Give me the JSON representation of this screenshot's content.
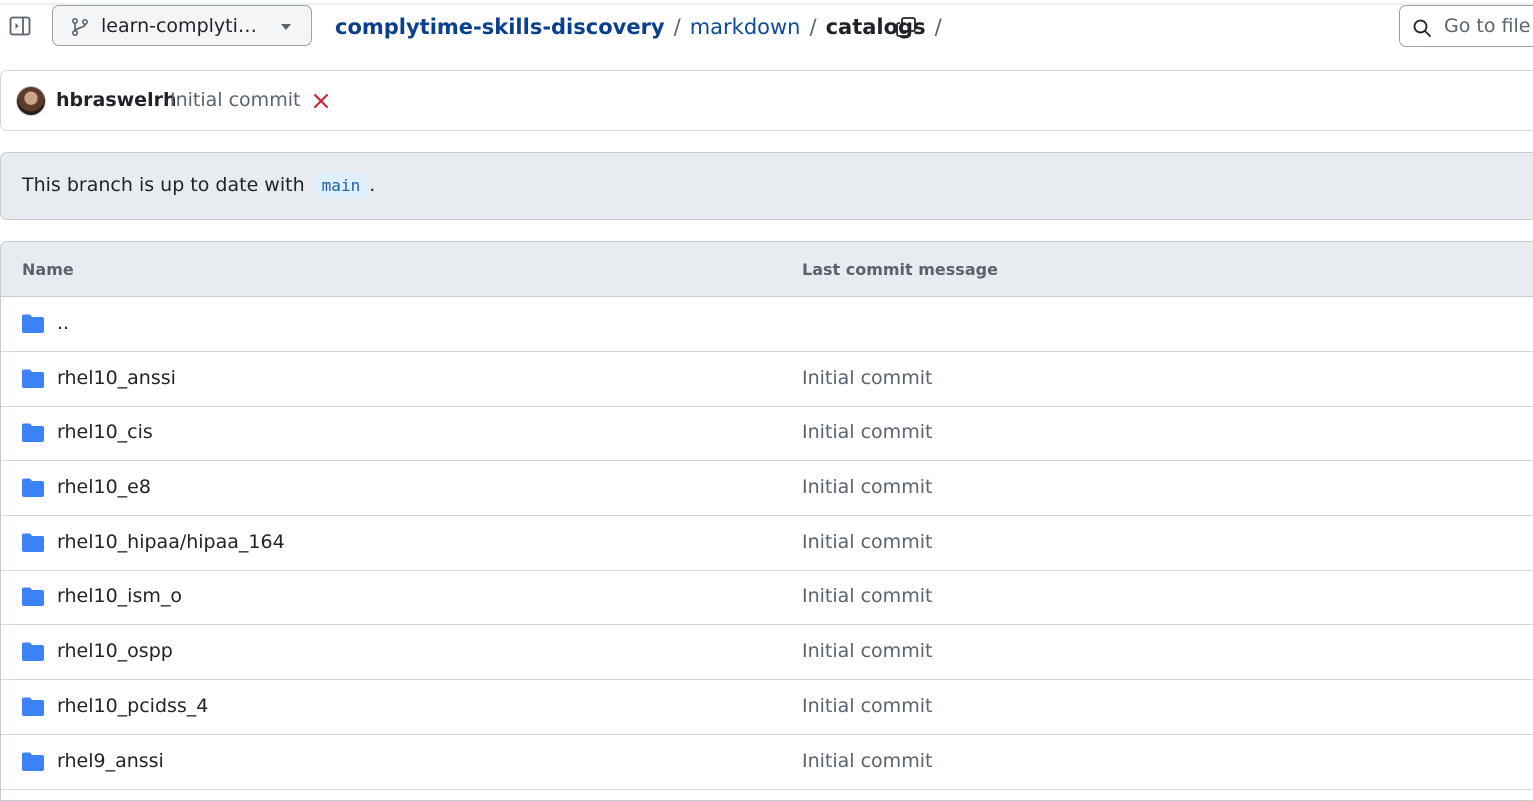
{
  "header": {
    "branch_name": "learn-complytime-skills-discovery",
    "breadcrumb": {
      "repo": "complytime-skills-discovery",
      "folder": "markdown",
      "current": "catalogs",
      "separator": "/"
    },
    "goto_file_label": "Go to file"
  },
  "commit": {
    "author": "hbraswelrh",
    "message": "Initial commit",
    "status_icon": "x-icon",
    "status_color": "#cf222e"
  },
  "branch_status": {
    "text_before": "This branch is up to date with",
    "branch": "main",
    "text_after": "."
  },
  "table": {
    "columns": [
      "Name",
      "Last commit message"
    ],
    "rows": [
      {
        "name": "..",
        "message": ""
      },
      {
        "name": "rhel10_anssi",
        "message": "Initial commit"
      },
      {
        "name": "rhel10_cis",
        "message": "Initial commit"
      },
      {
        "name": "rhel10_e8",
        "message": "Initial commit"
      },
      {
        "name": "rhel10_hipaa/hipaa_164",
        "message": "Initial commit"
      },
      {
        "name": "rhel10_ism_o",
        "message": "Initial commit"
      },
      {
        "name": "rhel10_ospp",
        "message": "Initial commit"
      },
      {
        "name": "rhel10_pcidss_4",
        "message": "Initial commit"
      },
      {
        "name": "rhel9_anssi",
        "message": "Initial commit"
      }
    ]
  },
  "colors": {
    "link": "#0e4a9c",
    "folder": "#3b82f6",
    "muted": "#59636e"
  }
}
